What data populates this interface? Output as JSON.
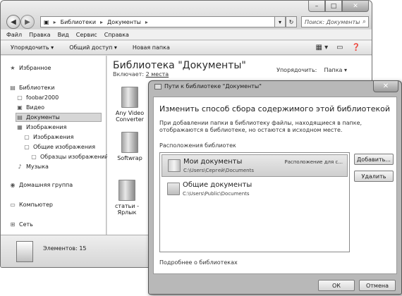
{
  "explorer": {
    "breadcrumb": [
      "Библиотеки",
      "Документы"
    ],
    "search_placeholder": "Поиск: Документы",
    "menu": [
      "Файл",
      "Правка",
      "Вид",
      "Сервис",
      "Справка"
    ],
    "commands": [
      "Упорядочить ▾",
      "Общий доступ ▾",
      "Новая папка"
    ],
    "sidebar": {
      "favorites": "Избранное",
      "libraries": "Библиотеки",
      "lib_items": [
        "foobar2000",
        "Видео",
        "Документы",
        "Изображения",
        "Изображения",
        "Общие изображения",
        "Образцы изображений",
        "Музыка"
      ],
      "homegroup": "Домашняя группа",
      "computer": "Компьютер",
      "network": "Сеть"
    },
    "library_title": "Библиотека \"Документы\"",
    "includes_label": "Включает:",
    "includes_link": "2 места",
    "arrange_label": "Упорядочить:",
    "arrange_value": "Папка ▾",
    "files": [
      {
        "label": "Any Video Converter"
      },
      {
        "label": "Softwrap"
      },
      {
        "label": "статьи - Ярлык"
      }
    ],
    "status": "Элементов: 15"
  },
  "dialog": {
    "title": "Пути к библиотеке \"Документы\"",
    "heading": "Изменить способ сбора содержимого этой библиотекой",
    "description": "При добавлении папки в библиотеку файлы, находящиеся в папке, отображаются в библиотеке, но остаются в исходном месте.",
    "locations_label": "Расположения библиотек",
    "locations": [
      {
        "name": "Мои документы",
        "path": "C:\\Users\\Сергей\\Documents",
        "tag": "Расположение для с..."
      },
      {
        "name": "Общие документы",
        "path": "C:\\Users\\Public\\Documents",
        "tag": ""
      }
    ],
    "add_button": "Добавить...",
    "remove_button": "Удалить",
    "more_link": "Подробнее о библиотеках",
    "ok_button": "ОК",
    "cancel_button": "Отмена"
  }
}
